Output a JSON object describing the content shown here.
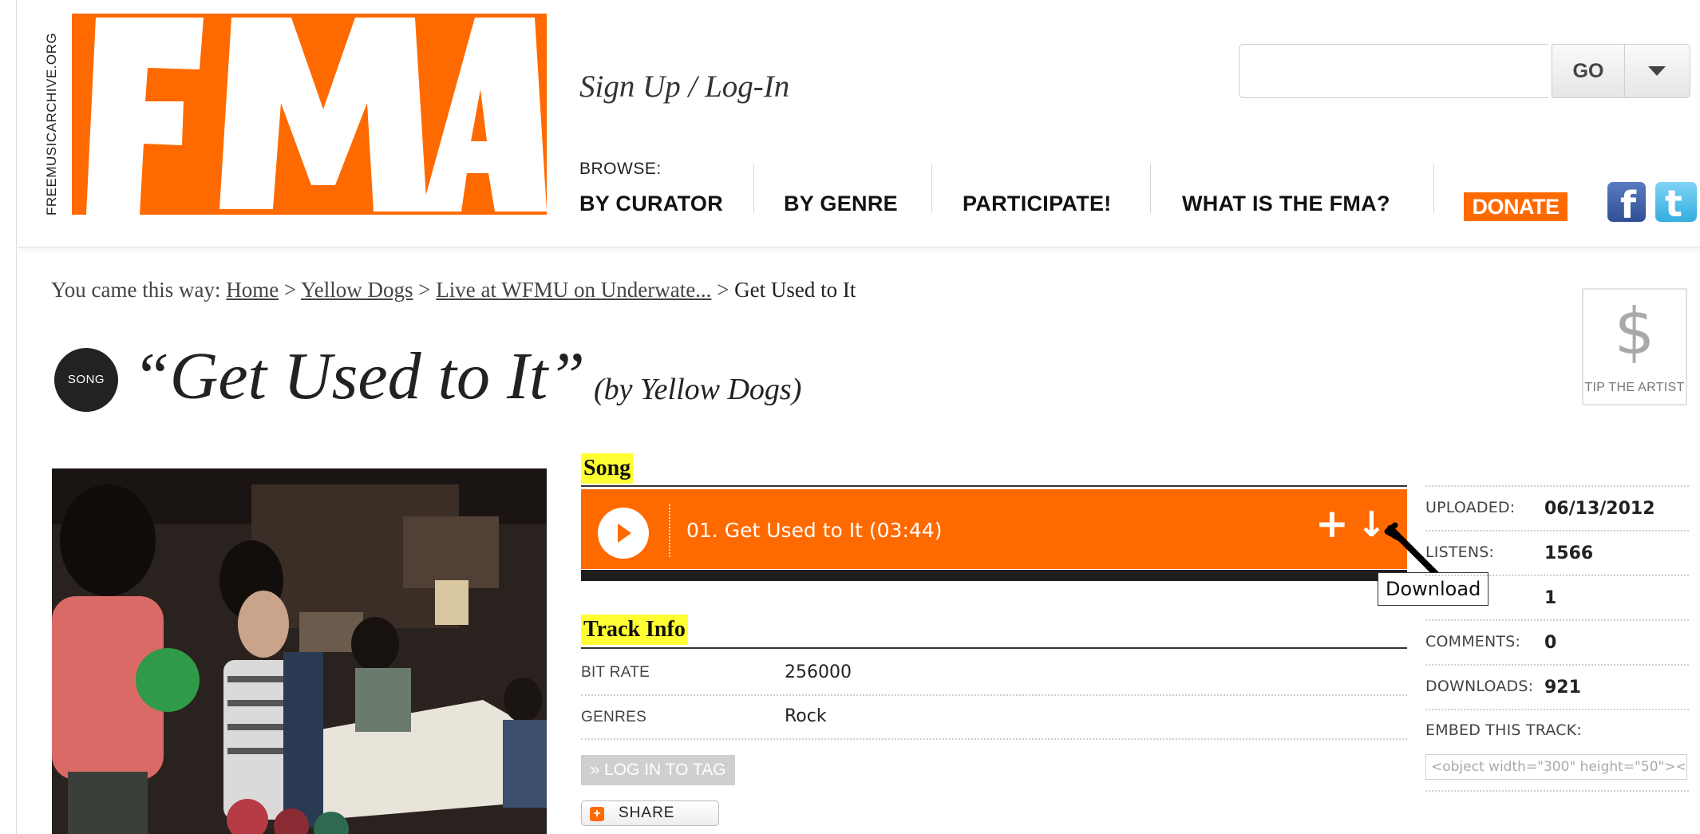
{
  "header": {
    "site_vertical": "FREEMUSICARCHIVE.ORG",
    "logo_text": "FMA",
    "signup_link": "Sign Up / Log-In",
    "browse_label": "BROWSE:",
    "nav": [
      "BY CURATOR",
      "BY GENRE",
      "PARTICIPATE!",
      "WHAT IS THE FMA?"
    ],
    "donate": "DONATE",
    "facebook_glyph": "f",
    "twitter_glyph": "t",
    "search": {
      "value": "",
      "go_label": "GO"
    }
  },
  "breadcrumb": {
    "prefix": "You came this way:",
    "items": [
      "Home",
      "Yellow Dogs",
      "Live at WFMU on Underwate..."
    ],
    "separator": ">",
    "current": "Get Used to It"
  },
  "tip": {
    "symbol": "$",
    "label": "TIP THE ARTIST"
  },
  "title": {
    "badge": "SONG",
    "song": "“Get Used to It”",
    "by": "(by Yellow Dogs)"
  },
  "player": {
    "section_label": "Song",
    "track": "01. Get Used to It (03:44)",
    "add_glyph": "+",
    "download_glyph": "↓",
    "tooltip": "Download"
  },
  "track_info": {
    "section_label": "Track Info",
    "rows": [
      {
        "label": "BIT RATE",
        "value": "256000"
      },
      {
        "label": "GENRES",
        "value": "Rock"
      }
    ],
    "login_tag": "» LOG IN TO TAG",
    "share": "SHARE"
  },
  "stats": [
    {
      "label": "UPLOADED:",
      "value": "06/13/2012"
    },
    {
      "label": "LISTENS:",
      "value": "1566"
    },
    {
      "label": "",
      "value": "1"
    },
    {
      "label": "COMMENTS:",
      "value": "0"
    },
    {
      "label": "DOWNLOADS:",
      "value": "921"
    }
  ],
  "embed": {
    "label": "EMBED THIS TRACK:",
    "code": "<object width=\"300\" height=\"50\"><"
  },
  "colors": {
    "brand_orange": "#ff6a00",
    "highlight_yellow": "#ffff33"
  }
}
